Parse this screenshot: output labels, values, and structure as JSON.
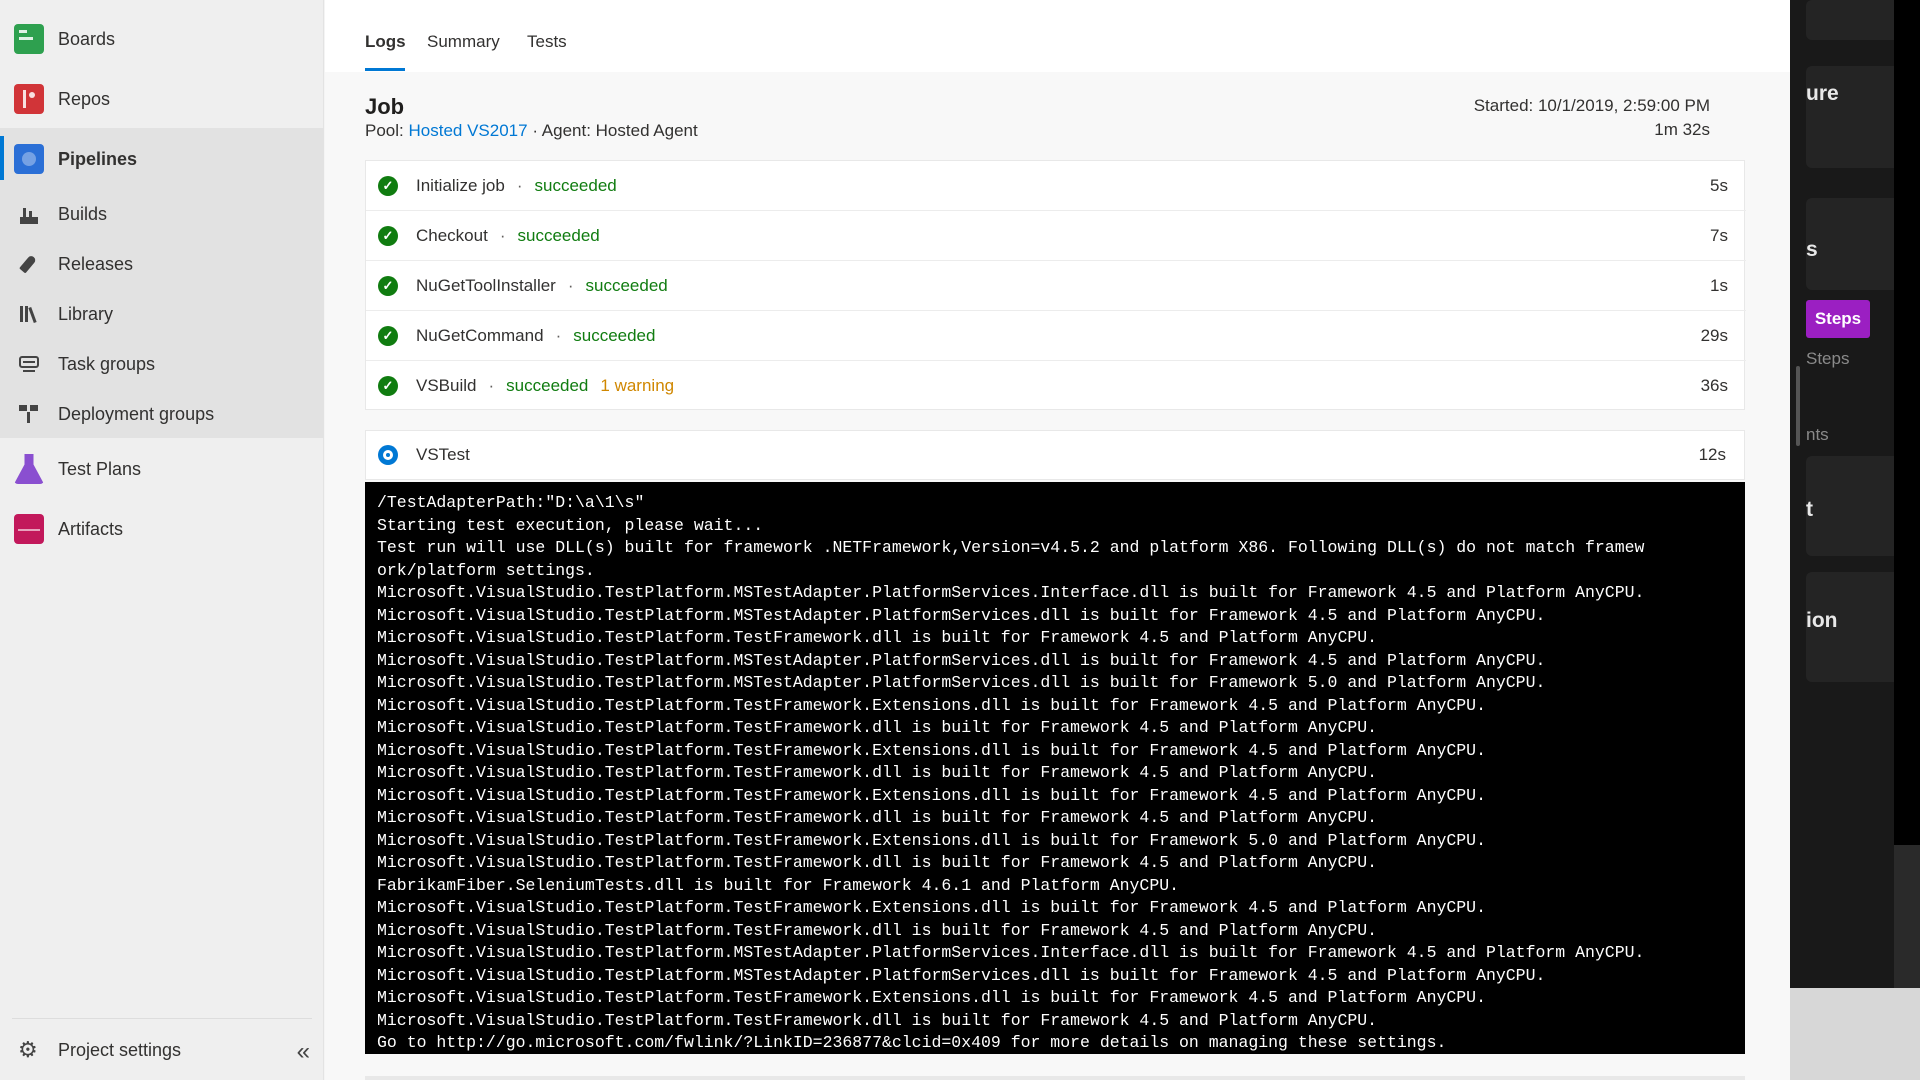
{
  "sidebar": {
    "items": [
      {
        "label": "Boards",
        "icon": "boards-icon"
      },
      {
        "label": "Repos",
        "icon": "repos-icon"
      },
      {
        "label": "Pipelines",
        "icon": "pipelines-icon"
      },
      {
        "label": "Builds",
        "icon": "builds-icon"
      },
      {
        "label": "Releases",
        "icon": "releases-icon"
      },
      {
        "label": "Library",
        "icon": "library-icon"
      },
      {
        "label": "Task groups",
        "icon": "task-groups-icon"
      },
      {
        "label": "Deployment groups",
        "icon": "deployment-groups-icon"
      },
      {
        "label": "Test Plans",
        "icon": "test-plans-icon"
      },
      {
        "label": "Artifacts",
        "icon": "artifacts-icon"
      }
    ],
    "footer": {
      "label": "Project settings",
      "collapse_glyph": "«"
    }
  },
  "tabs": [
    {
      "label": "Logs",
      "active": true
    },
    {
      "label": "Summary",
      "active": false
    },
    {
      "label": "Tests",
      "active": false
    }
  ],
  "job": {
    "title": "Job",
    "pool_prefix": "Pool:",
    "pool_link": "Hosted VS2017",
    "separator": "·",
    "agent": "Agent: Hosted Agent",
    "started": "Started: 10/1/2019, 2:59:00 PM",
    "duration": "1m 32s"
  },
  "steps": [
    {
      "name": "Initialize job",
      "status": "succeeded",
      "warning": "",
      "time": "5s"
    },
    {
      "name": "Checkout",
      "status": "succeeded",
      "warning": "",
      "time": "7s"
    },
    {
      "name": "NuGetToolInstaller",
      "status": "succeeded",
      "warning": "",
      "time": "1s"
    },
    {
      "name": "NuGetCommand",
      "status": "succeeded",
      "warning": "",
      "time": "29s"
    },
    {
      "name": "VSBuild",
      "status": "succeeded",
      "warning": "1 warning",
      "time": "36s"
    }
  ],
  "running_step": {
    "name": "VSTest",
    "time": "12s"
  },
  "console_lines": [
    "/TestAdapterPath:\"D:\\a\\1\\s\"",
    "Starting test execution, please wait...",
    "Test run will use DLL(s) built for framework .NETFramework,Version=v4.5.2 and platform X86. Following DLL(s) do not match framew",
    "ork/platform settings.",
    "Microsoft.VisualStudio.TestPlatform.MSTestAdapter.PlatformServices.Interface.dll is built for Framework 4.5 and Platform AnyCPU.",
    "Microsoft.VisualStudio.TestPlatform.MSTestAdapter.PlatformServices.dll is built for Framework 4.5 and Platform AnyCPU.",
    "Microsoft.VisualStudio.TestPlatform.TestFramework.dll is built for Framework 4.5 and Platform AnyCPU.",
    "Microsoft.VisualStudio.TestPlatform.MSTestAdapter.PlatformServices.dll is built for Framework 4.5 and Platform AnyCPU.",
    "Microsoft.VisualStudio.TestPlatform.MSTestAdapter.PlatformServices.dll is built for Framework 5.0 and Platform AnyCPU.",
    "Microsoft.VisualStudio.TestPlatform.TestFramework.Extensions.dll is built for Framework 4.5 and Platform AnyCPU.",
    "Microsoft.VisualStudio.TestPlatform.TestFramework.dll is built for Framework 4.5 and Platform AnyCPU.",
    "Microsoft.VisualStudio.TestPlatform.TestFramework.Extensions.dll is built for Framework 4.5 and Platform AnyCPU.",
    "Microsoft.VisualStudio.TestPlatform.TestFramework.dll is built for Framework 4.5 and Platform AnyCPU.",
    "Microsoft.VisualStudio.TestPlatform.TestFramework.Extensions.dll is built for Framework 4.5 and Platform AnyCPU.",
    "Microsoft.VisualStudio.TestPlatform.TestFramework.dll is built for Framework 4.5 and Platform AnyCPU.",
    "Microsoft.VisualStudio.TestPlatform.TestFramework.Extensions.dll is built for Framework 5.0 and Platform AnyCPU.",
    "Microsoft.VisualStudio.TestPlatform.TestFramework.dll is built for Framework 4.5 and Platform AnyCPU.",
    "FabrikamFiber.SeleniumTests.dll is built for Framework 4.6.1 and Platform AnyCPU.",
    "Microsoft.VisualStudio.TestPlatform.TestFramework.Extensions.dll is built for Framework 4.5 and Platform AnyCPU.",
    "Microsoft.VisualStudio.TestPlatform.TestFramework.dll is built for Framework 4.5 and Platform AnyCPU.",
    "Microsoft.VisualStudio.TestPlatform.MSTestAdapter.PlatformServices.Interface.dll is built for Framework 4.5 and Platform AnyCPU.",
    "Microsoft.VisualStudio.TestPlatform.MSTestAdapter.PlatformServices.dll is built for Framework 4.5 and Platform AnyCPU.",
    "Microsoft.VisualStudio.TestPlatform.TestFramework.Extensions.dll is built for Framework 4.5 and Platform AnyCPU.",
    "Microsoft.VisualStudio.TestPlatform.TestFramework.dll is built for Framework 4.5 and Platform AnyCPU.",
    "Go to http://go.microsoft.com/fwlink/?LinkID=236877&clcid=0x409 for more details on managing these settings."
  ],
  "overlay": {
    "text_1": "ure",
    "text_2": "s",
    "steps_button": "Steps",
    "steps_small": "Steps",
    "text_3": "nts",
    "text_4": "t",
    "text_5": "ion"
  },
  "colors": {
    "accent": "#0078d4",
    "success": "#107c10",
    "warning": "#d08700",
    "overlay_button": "#9b1fc2"
  }
}
